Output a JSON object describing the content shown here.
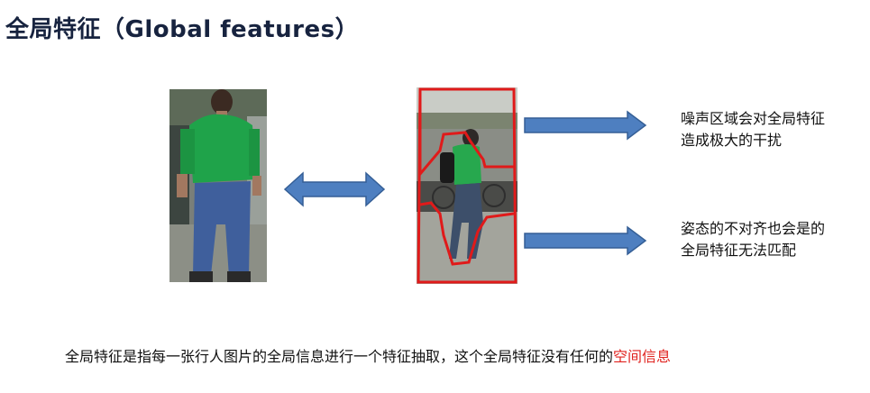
{
  "title": "全局特征（Global features）",
  "notes": {
    "noise": [
      "噪声区域会对全局特征",
      "造成极大的干扰"
    ],
    "misalign": [
      "姿态的不对齐也会是的",
      "全局特征无法匹配"
    ]
  },
  "footer": {
    "text": "全局特征是指每一张行人图片的全局信息进行一个特征抽取，这个全局特征没有任何的",
    "highlight": "空间信息"
  },
  "colors": {
    "arrow_fill": "#4e7fc0",
    "arrow_stroke": "#355f96",
    "outline": "#e01a1a",
    "highlight": "#e0231f"
  }
}
